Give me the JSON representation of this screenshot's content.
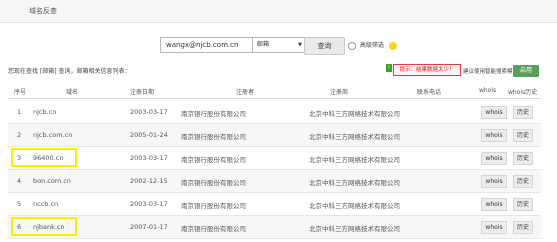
{
  "header": {
    "title": "域名反查"
  },
  "search": {
    "value": "wangx@njcb.com.cn",
    "select_value": "邮箱",
    "button": "查询",
    "advanced_label": "高级筛选"
  },
  "info": {
    "text": "您现在查找 [邮箱] 查询，邮箱相关信息列表：",
    "tip": "提示：结果数据太少！",
    "tip_tail": "建议使用智能搜索模式",
    "enable_button": "启用"
  },
  "table": {
    "headers": [
      "序号",
      "域名",
      "注册日期",
      "注册者",
      "注册商",
      "联系电话",
      "whois",
      "whois历史"
    ],
    "rows": [
      {
        "idx": "1",
        "domain": "njcb.cn",
        "date": "2003-03-17",
        "registrant": "南京银行股份有限公司",
        "registrar": "北京中科三方网络技术有限公司",
        "phone": "",
        "whois": "whois",
        "history": "历史",
        "highlight": false
      },
      {
        "idx": "2",
        "domain": "njcb.com.cn",
        "date": "2005-01-24",
        "registrant": "南京银行股份有限公司",
        "registrar": "北京中科三方网络技术有限公司",
        "phone": "",
        "whois": "whois",
        "history": "历史",
        "highlight": false
      },
      {
        "idx": "3",
        "domain": "96400.cn",
        "date": "2003-03-17",
        "registrant": "南京银行股份有限公司",
        "registrar": "北京中科三方网络技术有限公司",
        "phone": "",
        "whois": "whois",
        "history": "历史",
        "highlight": true
      },
      {
        "idx": "4",
        "domain": "bon.com.cn",
        "date": "2002-12-15",
        "registrant": "南京银行股份有限公司",
        "registrar": "北京中科三方网络技术有限公司",
        "phone": "",
        "whois": "whois",
        "history": "历史",
        "highlight": false
      },
      {
        "idx": "5",
        "domain": "nccb.cn",
        "date": "2003-03-17",
        "registrant": "南京银行股份有限公司",
        "registrar": "北京中科三方网络技术有限公司",
        "phone": "",
        "whois": "whois",
        "history": "历史",
        "highlight": false
      },
      {
        "idx": "6",
        "domain": "njbank.cn",
        "date": "2007-01-17",
        "registrant": "南京银行股份有限公司",
        "registrar": "北京中科三方网络技术有限公司",
        "phone": "",
        "whois": "whois",
        "history": "历史",
        "highlight": true
      }
    ]
  },
  "colors": {
    "highlight": "#f7f000",
    "tip_red": "#d81515",
    "enable_green": "#5aa05a"
  },
  "icons": {
    "advanced": "emoji-face-icon",
    "tip": "info-icon",
    "select": "chevron-down-icon"
  }
}
